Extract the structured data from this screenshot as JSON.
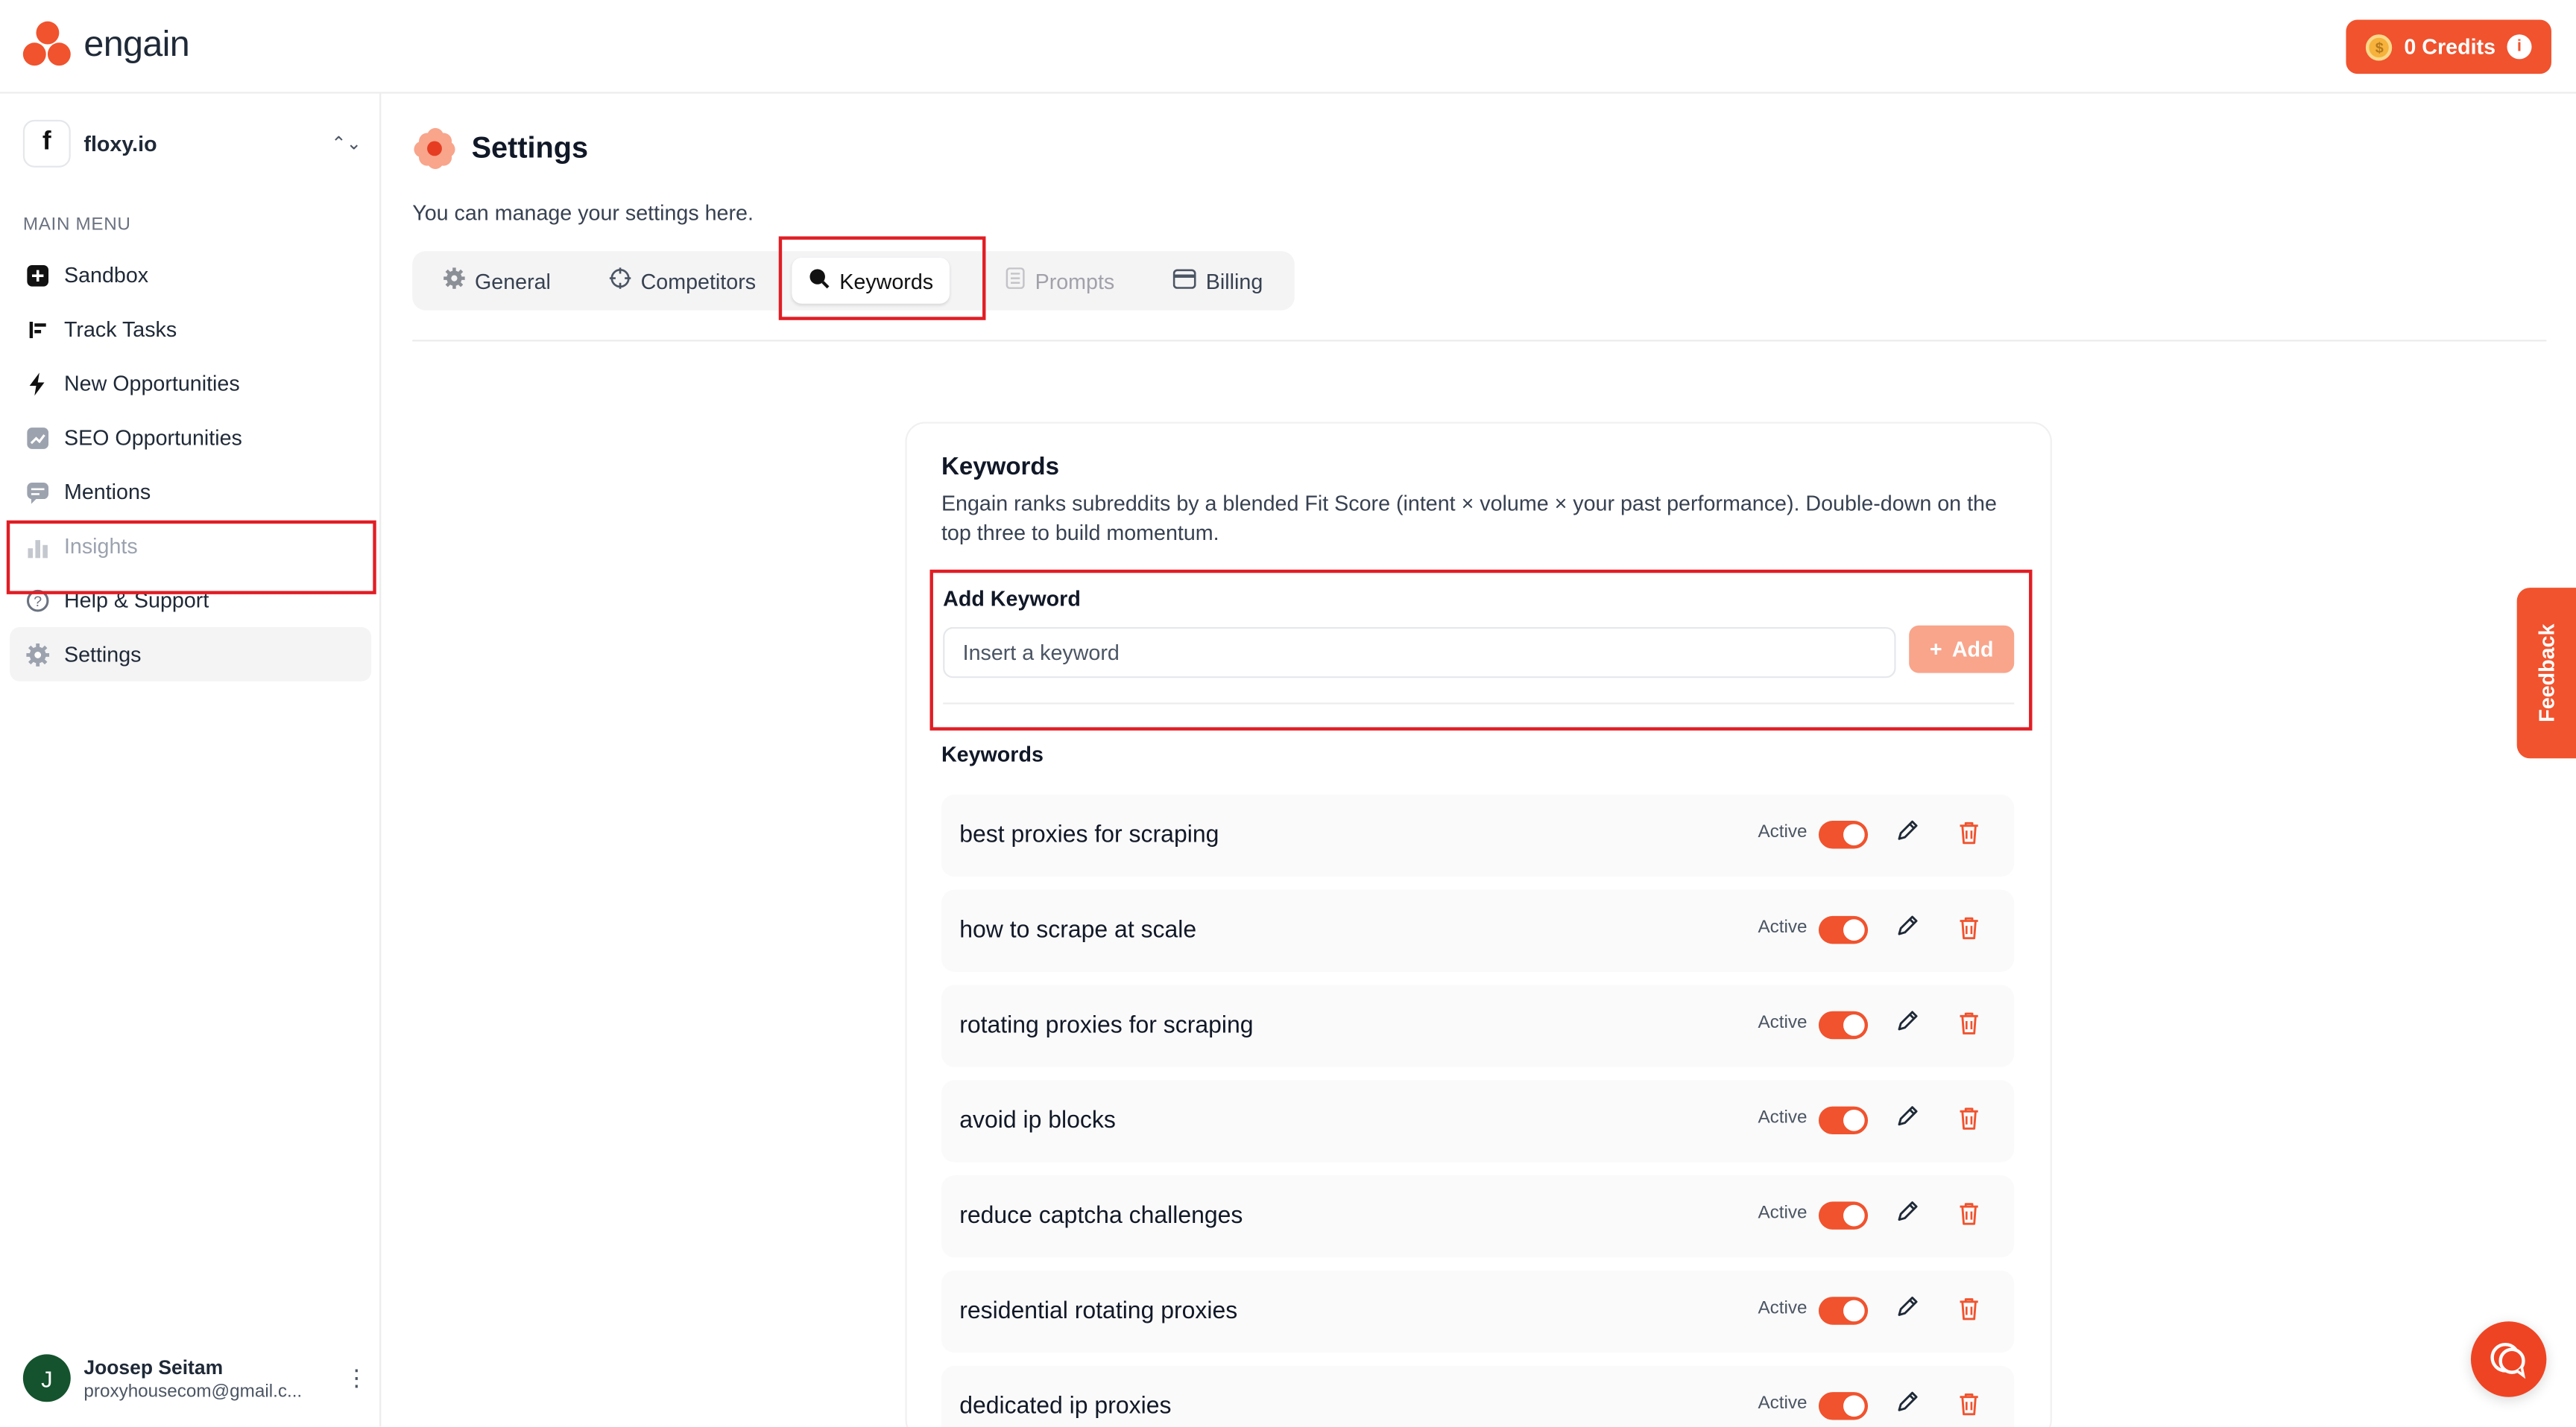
{
  "brand": {
    "name": "engain",
    "accent": "#f0532e"
  },
  "credits": {
    "label": "0 Credits"
  },
  "workspace": {
    "logo": "f",
    "name": "floxy.io"
  },
  "sidebar": {
    "menu_label": "MAIN MENU",
    "items": [
      {
        "label": "Sandbox",
        "icon": "plus-square-icon"
      },
      {
        "label": "Track Tasks",
        "icon": "list-icon"
      },
      {
        "label": "New Opportunities",
        "icon": "bolt-icon"
      },
      {
        "label": "SEO Opportunities",
        "icon": "chart-icon"
      },
      {
        "label": "Mentions",
        "icon": "message-icon"
      },
      {
        "label": "Insights",
        "icon": "bar-chart-icon"
      },
      {
        "label": "Help & Support",
        "icon": "help-icon"
      },
      {
        "label": "Settings",
        "icon": "gear-icon"
      }
    ]
  },
  "user": {
    "initial": "J",
    "name": "Joosep Seitam",
    "email": "proxyhousecom@gmail.c..."
  },
  "page": {
    "title": "Settings",
    "subtitle": "You can manage your settings here."
  },
  "tabs": [
    {
      "label": "General"
    },
    {
      "label": "Competitors"
    },
    {
      "label": "Keywords"
    },
    {
      "label": "Prompts"
    },
    {
      "label": "Billing"
    }
  ],
  "keywords_card": {
    "title": "Keywords",
    "description": "Engain ranks subreddits by a blended Fit Score (intent × volume × your past performance). Double-down on the top three to build momentum.",
    "add_label": "Add Keyword",
    "input_placeholder": "Insert a keyword",
    "add_button": "Add",
    "list_label": "Keywords",
    "status_label": "Active",
    "items": [
      "best proxies for scraping",
      "how to scrape at scale",
      "rotating proxies for scraping",
      "avoid ip blocks",
      "reduce captcha challenges",
      "residential rotating proxies",
      "dedicated ip proxies"
    ]
  },
  "feedback": {
    "label": "Feedback"
  }
}
